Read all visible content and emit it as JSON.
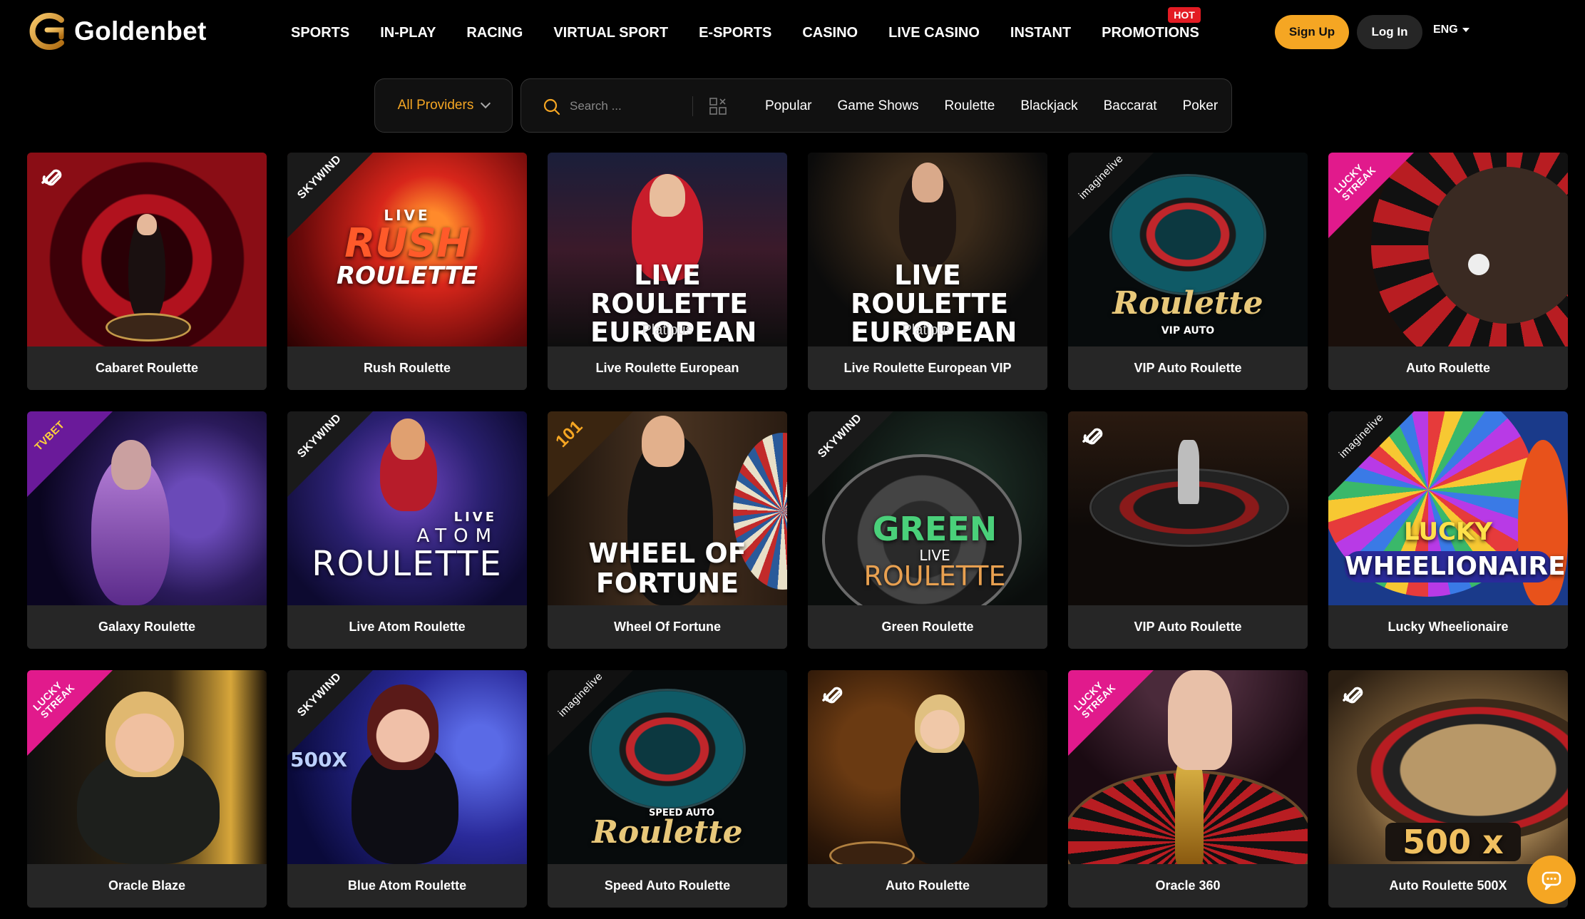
{
  "brand": {
    "name": "Goldenbet",
    "accent": "#f5a623",
    "hot_color": "#e31b23"
  },
  "nav": {
    "items": [
      "SPORTS",
      "IN-PLAY",
      "RACING",
      "VIRTUAL SPORT",
      "E-SPORTS",
      "CASINO",
      "LIVE CASINO",
      "INSTANT",
      "PROMOTIONS"
    ],
    "hot_badge": "HOT"
  },
  "auth": {
    "signup": "Sign Up",
    "login": "Log In",
    "language": "ENG"
  },
  "filters": {
    "providers_label": "All Providers",
    "search_placeholder": "Search ...",
    "categories": [
      "Popular",
      "Game Shows",
      "Roulette",
      "Blackjack",
      "Baccarat",
      "Poker"
    ]
  },
  "games": [
    {
      "title": "Cabaret Roulette",
      "provider_icon": "link-icon",
      "thumb_text": "",
      "thumb_sub": ""
    },
    {
      "title": "Rush Roulette",
      "provider_label": "SKYWIND",
      "thumb_top": "LIVE",
      "thumb_text": "RUSH",
      "thumb_sub": "ROULETTE"
    },
    {
      "title": "Live Roulette European",
      "thumb_text": "LIVE ROULETTE EUROPEAN",
      "thumb_sub": "Platipus"
    },
    {
      "title": "Live Roulette European VIP",
      "thumb_text": "LIVE ROULETTE EUROPEAN VIP",
      "thumb_sub": "Platipus"
    },
    {
      "title": "VIP Auto Roulette",
      "provider_label": "imaginelive",
      "thumb_text": "Roulette",
      "thumb_sub": "VIP AUTO"
    },
    {
      "title": "Auto Roulette",
      "provider_label": "LUCKY STREAK",
      "thumb_text": "",
      "thumb_sub": ""
    },
    {
      "title": "Galaxy Roulette",
      "provider_label": "TVBET",
      "thumb_text": "",
      "thumb_sub": ""
    },
    {
      "title": "Live Atom Roulette",
      "provider_label": "SKYWIND",
      "thumb_top": "LIVE",
      "thumb_text": "ATOM",
      "thumb_sub": "ROULETTE"
    },
    {
      "title": "Wheel Of Fortune",
      "provider_label": "101",
      "thumb_text": "WHEEL OF",
      "thumb_sub": "FORTUNE"
    },
    {
      "title": "Green Roulette",
      "provider_label": "SKYWIND",
      "thumb_top": "GREEN",
      "thumb_text": "LIVE",
      "thumb_sub": "ROULETTE"
    },
    {
      "title": "VIP Auto Roulette",
      "provider_icon": "link-icon",
      "thumb_text": "",
      "thumb_sub": ""
    },
    {
      "title": "Lucky Wheelionaire",
      "provider_label": "imaginelive",
      "thumb_text": "LUCKY",
      "thumb_sub": "WHEELIONAIRE"
    },
    {
      "title": "Oracle Blaze",
      "provider_label": "LUCKY STREAK",
      "thumb_text": "",
      "thumb_sub": ""
    },
    {
      "title": "Blue Atom Roulette",
      "provider_label": "SKYWIND",
      "thumb_text": "500X",
      "thumb_sub": ""
    },
    {
      "title": "Speed Auto Roulette",
      "provider_label": "imaginelive",
      "thumb_top": "SPEED AUTO",
      "thumb_text": "Roulette",
      "thumb_sub": ""
    },
    {
      "title": "Auto Roulette",
      "provider_icon": "link-icon",
      "thumb_text": "",
      "thumb_sub": ""
    },
    {
      "title": "Oracle 360",
      "provider_label": "LUCKY STREAK",
      "thumb_text": "",
      "thumb_sub": ""
    },
    {
      "title": "Auto Roulette 500X",
      "provider_icon": "link-icon",
      "thumb_text": "500 x",
      "thumb_sub": ""
    }
  ]
}
